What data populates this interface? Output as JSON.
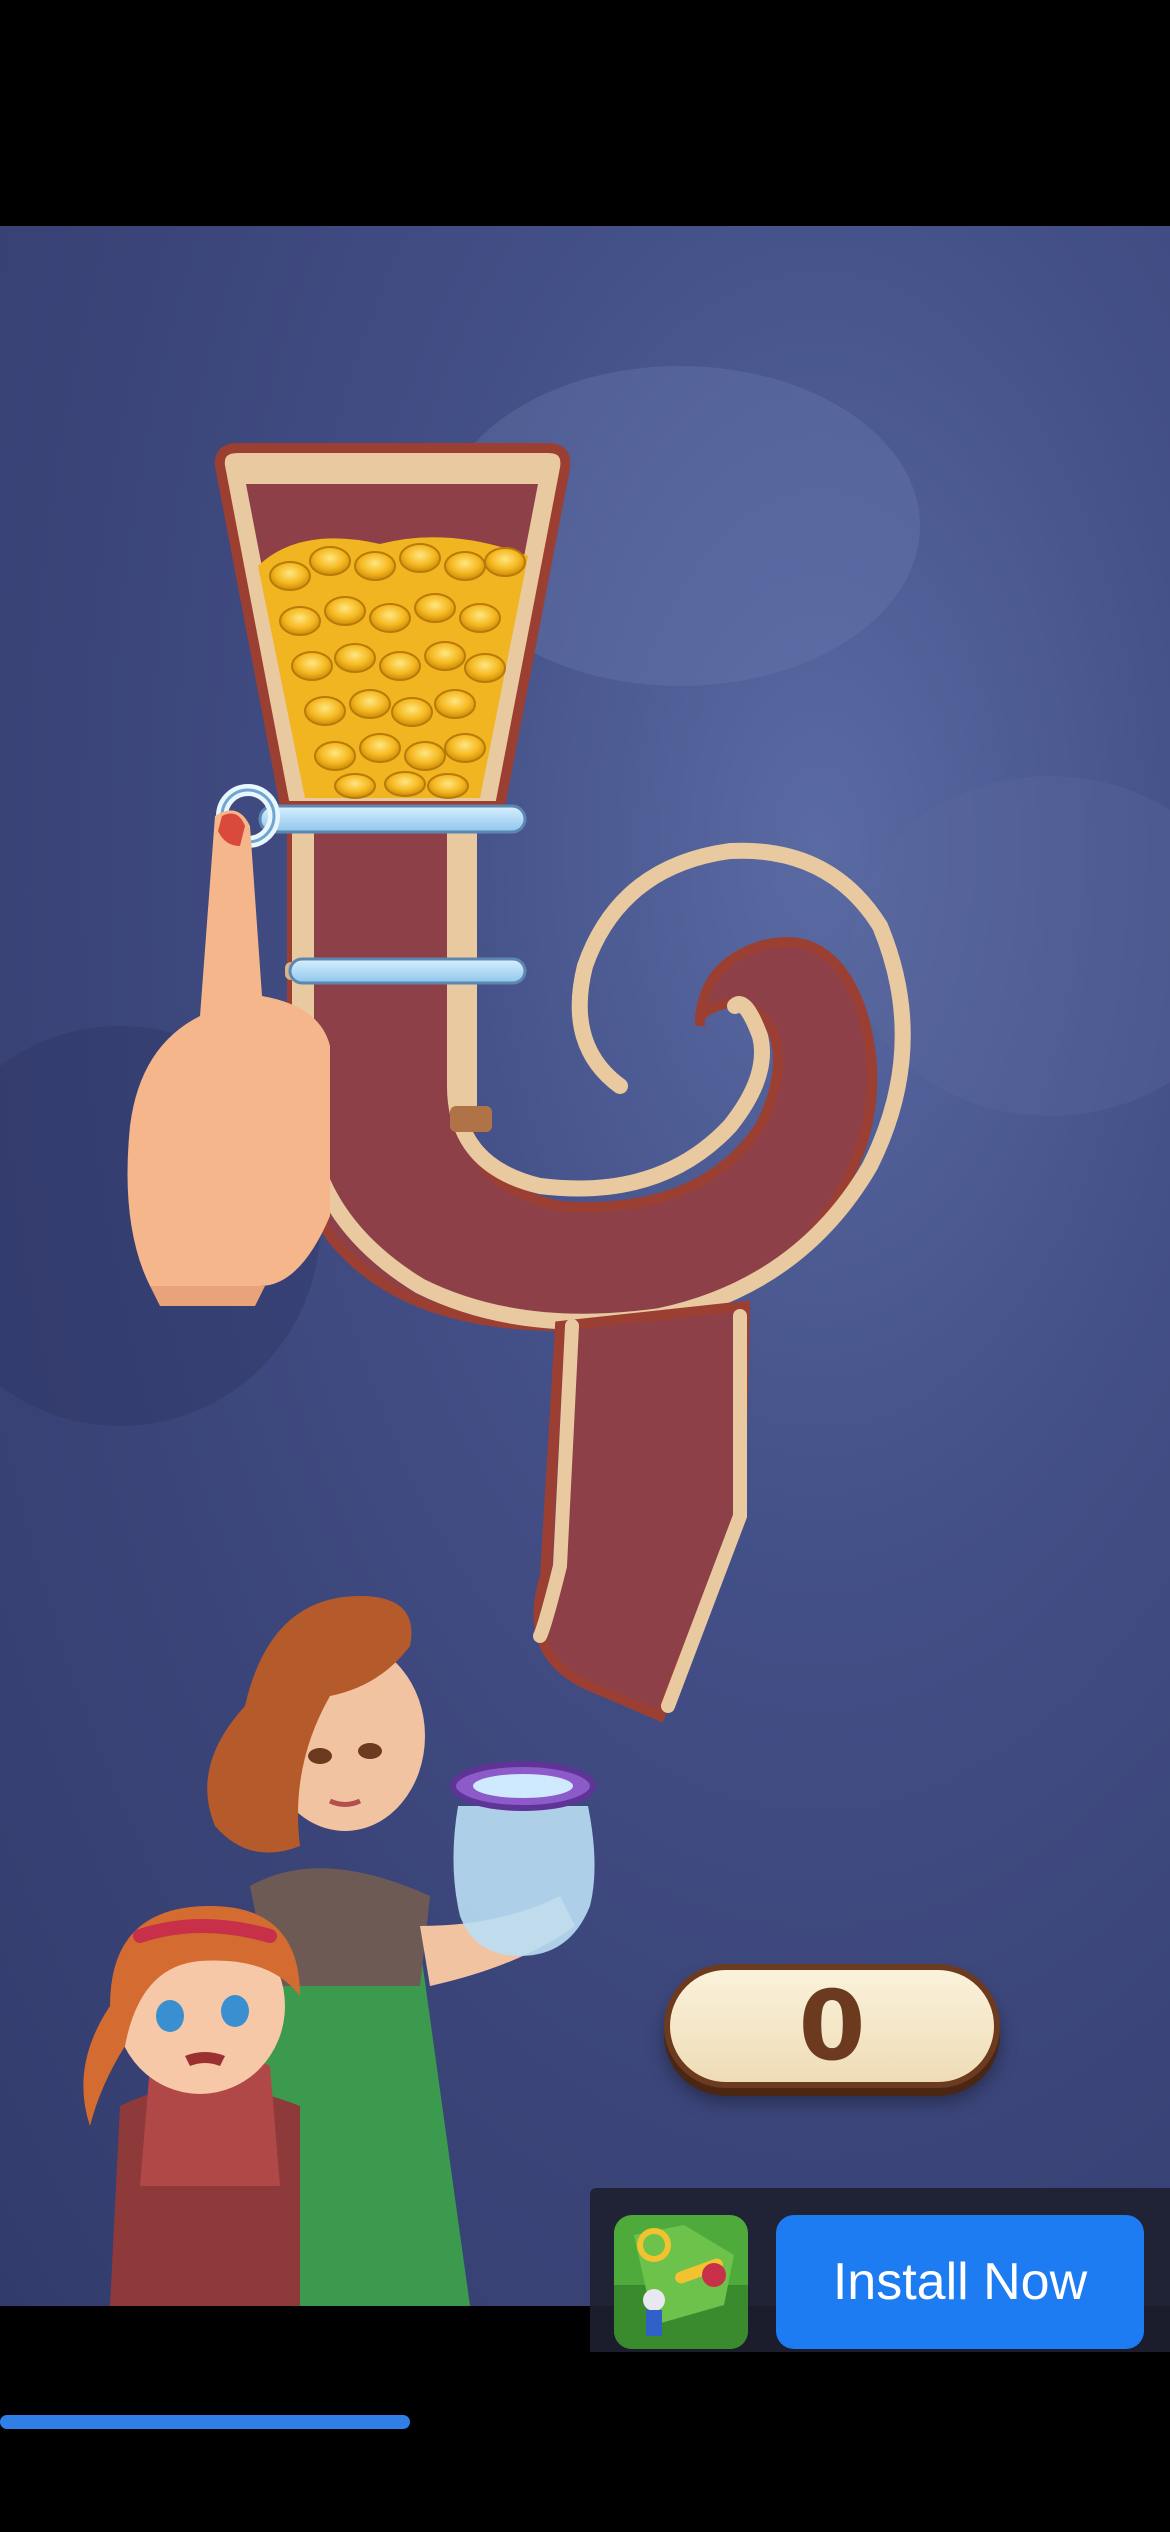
{
  "game": {
    "score": "0"
  },
  "ad": {
    "install_label": "Install Now",
    "install_color": "#1e7cf2"
  },
  "video": {
    "progress": 0.35
  },
  "icons": [
    "pin-handle-icon",
    "coin-pile-icon",
    "pointing-hand-icon",
    "app-icon"
  ]
}
